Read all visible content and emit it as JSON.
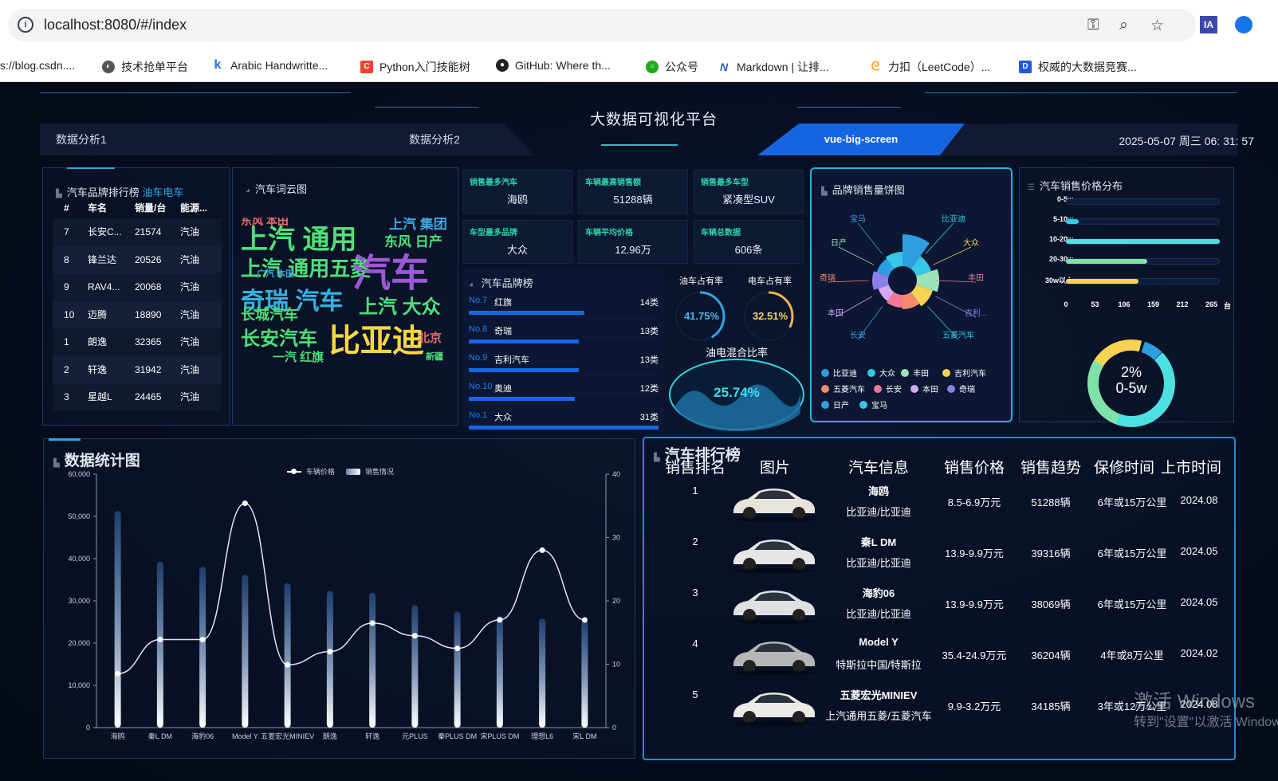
{
  "browser": {
    "url": "localhost:8080/#/index",
    "bookmarks": [
      {
        "label": "s://blog.csdn....",
        "color": "#fff"
      },
      {
        "label": "技术抢单平台",
        "color": "#555"
      },
      {
        "label": "Arabic Handwritte...",
        "color": "#1a73e8"
      },
      {
        "label": "Python入门技能树",
        "color": "#e8472b"
      },
      {
        "label": "GitHub: Where th...",
        "color": "#222"
      },
      {
        "label": "公众号",
        "color": "#1aad19"
      },
      {
        "label": "Markdown | 让排...",
        "color": "#2364c8"
      },
      {
        "label": "力扣（LeetCode）...",
        "color": "#f89f1b"
      },
      {
        "label": "权威的大数据竞赛...",
        "color": "#1f5ad6"
      }
    ],
    "ext_label": "IA"
  },
  "header": {
    "title": "大数据可视化平台",
    "tabs": [
      "数据分析1",
      "数据分析2",
      "vue-big-screen"
    ],
    "datetime": "2025-05-07 周三 06: 31: 57"
  },
  "brand_rank": {
    "title": "汽车品牌排行榜",
    "toggle": "油车电车",
    "columns": [
      "#",
      "车名",
      "销量/台",
      "能源..."
    ],
    "rows": [
      [
        "7",
        "长安C...",
        "21574",
        "汽油"
      ],
      [
        "8",
        "锋兰达",
        "20526",
        "汽油"
      ],
      [
        "9",
        "RAV4...",
        "20068",
        "汽油"
      ],
      [
        "10",
        "迈腾",
        "18890",
        "汽油"
      ],
      [
        "1",
        "朗逸",
        "32365",
        "汽油"
      ],
      [
        "2",
        "轩逸",
        "31942",
        "汽油"
      ],
      [
        "3",
        "星越L",
        "24465",
        "汽油"
      ]
    ]
  },
  "wordcloud": {
    "title": "汽车词云图",
    "words": [
      {
        "t": "上汽 通用",
        "c": "#4ee07a"
      },
      {
        "t": "上汽 通用五菱",
        "c": "#4ee07a"
      },
      {
        "t": "汽车",
        "c": "#9b59d6"
      },
      {
        "t": "奇瑞 汽车",
        "c": "#33b3e0"
      },
      {
        "t": "比亚迪",
        "c": "#f6d743"
      },
      {
        "t": "长安汽车",
        "c": "#4ee07a"
      },
      {
        "t": "上汽 大众",
        "c": "#4ee07a"
      },
      {
        "t": "东风 日产",
        "c": "#4ee07a"
      },
      {
        "t": "上汽 集团",
        "c": "#3fa7e0"
      },
      {
        "t": "长城汽车",
        "c": "#4ee07a"
      },
      {
        "t": "一汽 红旗",
        "c": "#4ee07a"
      },
      {
        "t": "东风 本田",
        "c": "#ea6a6a"
      },
      {
        "t": "广汽 本田",
        "c": "#3fa7e0"
      },
      {
        "t": "北京",
        "c": "#ea6a6a"
      },
      {
        "t": "新疆",
        "c": "#4ee07a"
      }
    ]
  },
  "stats": [
    {
      "label": "销售最多汽车",
      "value": "海鸥"
    },
    {
      "label": "车辆最高销售额",
      "value": "51288辆"
    },
    {
      "label": "销售最多车型",
      "value": "紧凑型SUV"
    },
    {
      "label": "车型最多品牌",
      "value": "大众"
    },
    {
      "label": "车辆平均价格",
      "value": "12.96万"
    },
    {
      "label": "车辆总数据",
      "value": "606条"
    }
  ],
  "brand_board": {
    "title": "汽车品牌榜",
    "items": [
      {
        "no": "No.7",
        "name": "红旗",
        "count": "14类",
        "ratio": 0.61
      },
      {
        "no": "No.8",
        "name": "奇瑞",
        "count": "13类",
        "ratio": 0.58
      },
      {
        "no": "No.9",
        "name": "吉利汽车",
        "count": "13类",
        "ratio": 0.58
      },
      {
        "no": "No.10",
        "name": "奥迪",
        "count": "12类",
        "ratio": 0.56
      },
      {
        "no": "No.1",
        "name": "大众",
        "count": "31类",
        "ratio": 1.0
      }
    ]
  },
  "share": {
    "oil_label": "油车占有率",
    "elec_label": "电车占有率",
    "oil_value": "41.75%",
    "elec_value": "32.51%",
    "mix_label": "油电混合比率",
    "mix_value": "25.74%",
    "oil_ratio": 0.4175,
    "elec_ratio": 0.3251
  },
  "pie": {
    "title": "品牌销售量饼图",
    "labels": [
      "宝马",
      "比亚迪",
      "日产",
      "大众",
      "奇瑞",
      "丰田",
      "本田",
      "吉利...",
      "长安",
      "五菱汽车"
    ],
    "legend": [
      {
        "name": "比亚迪",
        "color": "#2f9ee0"
      },
      {
        "name": "大众",
        "color": "#36c8e6"
      },
      {
        "name": "丰田",
        "color": "#9ee2b8"
      },
      {
        "name": "吉利汽车",
        "color": "#f6d350"
      },
      {
        "name": "五菱汽车",
        "color": "#f48a6b"
      },
      {
        "name": "长安",
        "color": "#f47896"
      },
      {
        "name": "本田",
        "color": "#d4a6f2"
      },
      {
        "name": "奇瑞",
        "color": "#8a7ee8"
      },
      {
        "name": "日产",
        "color": "#2f9ee0"
      },
      {
        "name": "宝马",
        "color": "#36c8e6"
      }
    ]
  },
  "price_dist": {
    "title": "汽车销售价格分布",
    "rows": [
      {
        "label": "0-5w",
        "value": 0,
        "color": "#2f9ee0"
      },
      {
        "label": "5-10w",
        "value": 22,
        "color": "#36c8e6"
      },
      {
        "label": "10-20w",
        "value": 265,
        "color": "#4de0e0"
      },
      {
        "label": "20-30w",
        "value": 140,
        "color": "#7ee2a8"
      },
      {
        "label": "30w以上",
        "value": 125,
        "color": "#f6d350"
      }
    ],
    "ticks": [
      "0",
      "53",
      "106",
      "159",
      "212",
      "265"
    ],
    "unit": "台",
    "donut_pct": "2%",
    "donut_label": "0-5w"
  },
  "chart_data": {
    "type": "line",
    "title": "数据统计图",
    "categories": [
      "海鸥",
      "秦L DM",
      "海豹06",
      "Model Y",
      "五菱宏光MINIEV",
      "朗逸",
      "轩逸",
      "元PLUS",
      "秦PLUS DM",
      "宋PLUS DM",
      "理想L6",
      "宋L DM"
    ],
    "series": [
      {
        "name": "车辆价格",
        "type": "line",
        "axis": "right",
        "values": [
          8.5,
          13.9,
          13.9,
          35.4,
          9.9,
          12.0,
          16.5,
          14.5,
          12.5,
          17.0,
          28.0,
          17.0
        ]
      },
      {
        "name": "销售情况",
        "type": "bar",
        "axis": "left",
        "values": [
          51288,
          39316,
          38069,
          36204,
          34185,
          32365,
          31942,
          29000,
          27500,
          26500,
          25800,
          25500
        ]
      }
    ],
    "y_left_ticks": [
      "0",
      "10,000",
      "20,000",
      "30,000",
      "40,000",
      "50,000",
      "60,000"
    ],
    "y_right_ticks": [
      "0",
      "10",
      "20",
      "30",
      "40"
    ],
    "ylim_left": [
      0,
      60000
    ],
    "ylim_right": [
      0,
      40
    ]
  },
  "car_rank": {
    "title": "汽车排行榜",
    "columns": [
      "销售排名",
      "图片",
      "汽车信息",
      "销售价格",
      "销售趋势",
      "保修时间",
      "上市时间"
    ],
    "rows": [
      {
        "rank": "1",
        "name": "海鸥",
        "brand": "比亚迪/比亚迪",
        "price": "8.5-6.9万元",
        "trend": "51288辆",
        "warranty": "6年或15万公里",
        "date": "2024.08",
        "color": "#e8e4dc"
      },
      {
        "rank": "2",
        "name": "秦L DM",
        "brand": "比亚迪/比亚迪",
        "price": "13.9-9.9万元",
        "trend": "39316辆",
        "warranty": "6年或15万公里",
        "date": "2024.05",
        "color": "#e6e6e6"
      },
      {
        "rank": "3",
        "name": "海豹06",
        "brand": "比亚迪/比亚迪",
        "price": "13.9-9.9万元",
        "trend": "38069辆",
        "warranty": "6年或15万公里",
        "date": "2024.05",
        "color": "#dfe0e2"
      },
      {
        "rank": "4",
        "name": "Model Y",
        "brand": "特斯拉中国/特斯拉",
        "price": "35.4-24.9万元",
        "trend": "36204辆",
        "warranty": "4年或8万公里",
        "date": "2024.02",
        "color": "#b4b6b8"
      },
      {
        "rank": "5",
        "name": "五菱宏光MINIEV",
        "brand": "上汽通用五菱/五菱汽车",
        "price": "9.9-3.2万元",
        "trend": "34185辆",
        "warranty": "3年或12万公里",
        "date": "2024.08",
        "color": "#eceae4"
      }
    ]
  },
  "watermark": {
    "line1": "激活 Windows",
    "line2": "转到\"设置\"以激活 Windows。"
  }
}
